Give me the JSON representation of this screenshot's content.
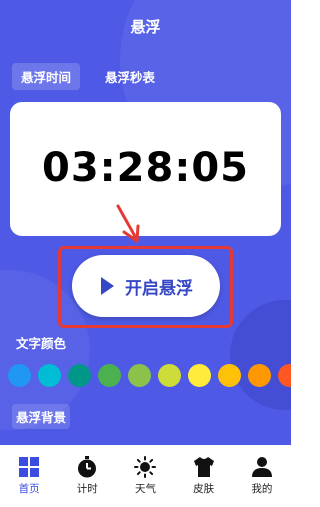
{
  "header": {
    "title": "悬浮"
  },
  "tabs": [
    {
      "label": "悬浮时间",
      "active": true
    },
    {
      "label": "悬浮秒表",
      "active": false
    }
  ],
  "clock": {
    "time": "03:28:05"
  },
  "float_button": {
    "label": "开启悬浮"
  },
  "text_color": {
    "label": "文字颜色",
    "swatches": [
      "#2196f3",
      "#00bcd4",
      "#009688",
      "#4caf50",
      "#8bc34a",
      "#cddc39",
      "#ffeb3b",
      "#ffc107",
      "#ff9800",
      "#ff5722"
    ]
  },
  "background": {
    "label": "悬浮背景"
  },
  "nav": {
    "items": [
      {
        "label": "首页",
        "icon": "home-grid-icon",
        "active": true
      },
      {
        "label": "计时",
        "icon": "timer-icon",
        "active": false
      },
      {
        "label": "天气",
        "icon": "sun-icon",
        "active": false
      },
      {
        "label": "皮肤",
        "icon": "shirt-icon",
        "active": false
      },
      {
        "label": "我的",
        "icon": "person-icon",
        "active": false
      }
    ]
  },
  "colors": {
    "accent": "#3b4ce0",
    "background": "#4e5ae6",
    "highlight": "#e53935"
  }
}
